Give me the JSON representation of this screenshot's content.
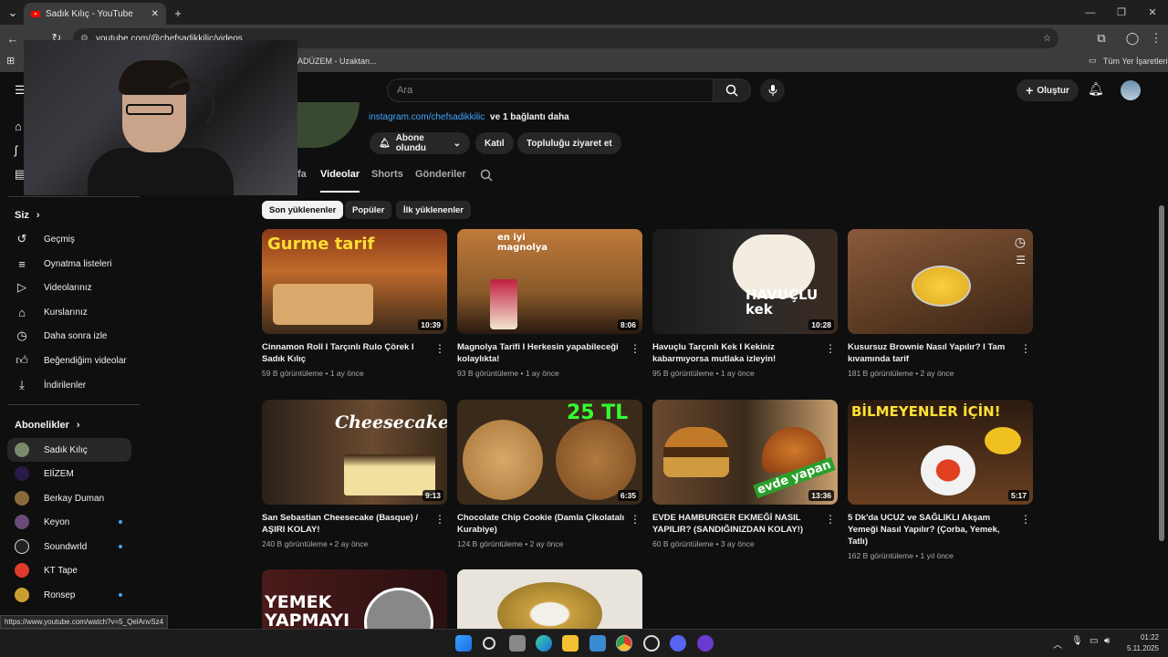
{
  "browser": {
    "tab_title": "Sadık Kılıç - YouTube",
    "url": "youtube.com/@chefsadikkilic/videos",
    "bookmark_partial": "ADÜZEM - Uzaktan...",
    "bookmarks_all": "Tüm Yer İşaretleri",
    "status_url": "https://www.youtube.com/watch?v=5_QelAnvSz4"
  },
  "header": {
    "search_placeholder": "Ara",
    "create_label": "Oluştur"
  },
  "channel": {
    "link_text": "instagram.com/chefsadikkilic",
    "link_more": "ve 1 bağlantı daha",
    "subscribed_label": "Abone olundu",
    "join_label": "Katıl",
    "community_label": "Topluluğu ziyaret et",
    "tabs": [
      "fa",
      "Videolar",
      "Shorts",
      "Gönderiler"
    ]
  },
  "filters": [
    "Son yüklenenler",
    "Popüler",
    "İlk yüklenenler"
  ],
  "sidebar": {
    "you_label": "Siz",
    "you_items": [
      "Geçmiş",
      "Oynatma listeleri",
      "Videolarınız",
      "Kurslarınız",
      "Daha sonra izle",
      "Beğendiğim videolar",
      "İndirilenler"
    ],
    "subs_label": "Abonelikler",
    "subs": [
      "Sadık Kılıç",
      "ElİZEM",
      "Berkay Duman",
      "Keyon",
      "Soundwrld",
      "KT Tape",
      "Ronsep"
    ]
  },
  "videos": [
    {
      "title": "Cinnamon Roll I Tarçınlı Rulo Çörek I Sadık Kılıç",
      "views": "59 B görüntüleme",
      "age": "1 ay önce",
      "duration": "10:39",
      "overlay": "Gurme tarif"
    },
    {
      "title": "Magnolya Tarifi I Herkesin yapabileceği kolaylıkta!",
      "views": "93 B görüntüleme",
      "age": "1 ay önce",
      "duration": "8:06",
      "overlay": "en iyi magnolya"
    },
    {
      "title": "Havuçlu Tarçınlı Kek I Kekiniz kabarmıyorsa mutlaka izleyin!",
      "views": "95 B görüntüleme",
      "age": "1 ay önce",
      "duration": "10:28",
      "overlay": "HAVUÇLU kek"
    },
    {
      "title": "Kusursuz Brownie Nasıl Yapılır? I Tam kıvamında tarif",
      "views": "181 B görüntüleme",
      "age": "2 ay önce",
      "duration": "",
      "overlay": ""
    },
    {
      "title": "San Sebastian Cheesecake (Basque) / AŞIRI KOLAY!",
      "views": "240 B görüntüleme",
      "age": "2 ay önce",
      "duration": "9:13",
      "overlay": "Cheesecake"
    },
    {
      "title": "Chocolate Chip Cookie (Damla Çikolatalı Kurabiye)",
      "views": "124 B görüntüleme",
      "age": "2 ay önce",
      "duration": "6:35",
      "overlay": "25 TL"
    },
    {
      "title": "EVDE HAMBURGER EKMEĞİ NASIL YAPILIR? (SANDIĞINIZDAN KOLAY!)",
      "views": "60 B görüntüleme",
      "age": "3 ay önce",
      "duration": "13:36",
      "overlay": "evde yapan"
    },
    {
      "title": "5 Dk'da UCUZ ve SAĞLIKLI Akşam Yemeği Nasıl Yapılır? (Çorba, Yemek, Tatlı)",
      "views": "162 B görüntüleme",
      "age": "1 yıl önce",
      "duration": "5:17",
      "overlay": "BİLMEYENLER İÇİN!"
    },
    {
      "title": "",
      "views": "",
      "age": "",
      "duration": "",
      "overlay": "YEMEK YAPMAYI"
    },
    {
      "title": "",
      "views": "",
      "age": "",
      "duration": "",
      "overlay": ""
    }
  ],
  "clock": {
    "time": "01:22",
    "date": "5.11.2025"
  }
}
